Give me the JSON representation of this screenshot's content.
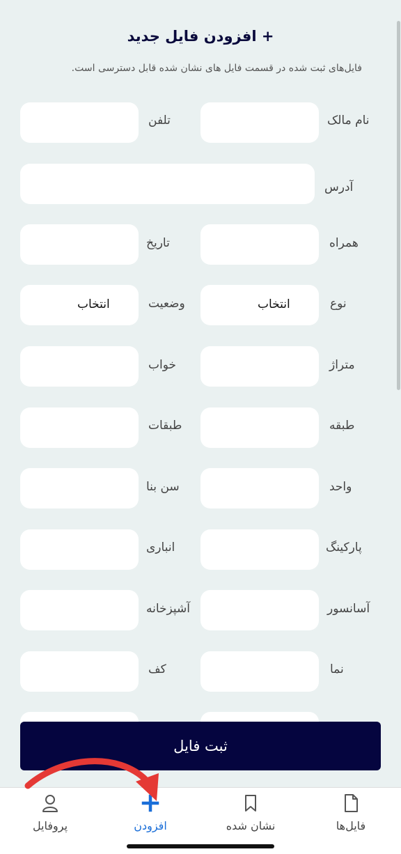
{
  "header": {
    "title": "+ افزودن فایل جدید",
    "subtitle": "فایل‌های ثبت شده در قسمت فایل های نشان شده قابل دسترسی است."
  },
  "form": {
    "owner_name": "نام مالک",
    "phone": "تلفن",
    "address": "آدرس",
    "mobile": "همراه",
    "date": "تاریخ",
    "type": "نوع",
    "type_value": "انتخاب",
    "status": "وضعیت",
    "status_value": "انتخاب",
    "area": "متراژ",
    "bedrooms": "خواب",
    "floor": "طبقه",
    "floors": "طبقات",
    "unit": "واحد",
    "building_age": "سن بنا",
    "parking": "پارکینگ",
    "storage": "انباری",
    "elevator": "آسانسور",
    "kitchen": "آشپزخانه",
    "facade": "نما",
    "flooring": "کف"
  },
  "submit_label": "ثبت فایل",
  "nav": {
    "files": "فایل‌ها",
    "bookmarked": "نشان شده",
    "add": "افزودن",
    "profile": "پروفایل"
  },
  "colors": {
    "background": "#eaf1f1",
    "primary": "#05053f",
    "active_tab": "#1a6ed8",
    "annotation_arrow": "#e53935"
  }
}
